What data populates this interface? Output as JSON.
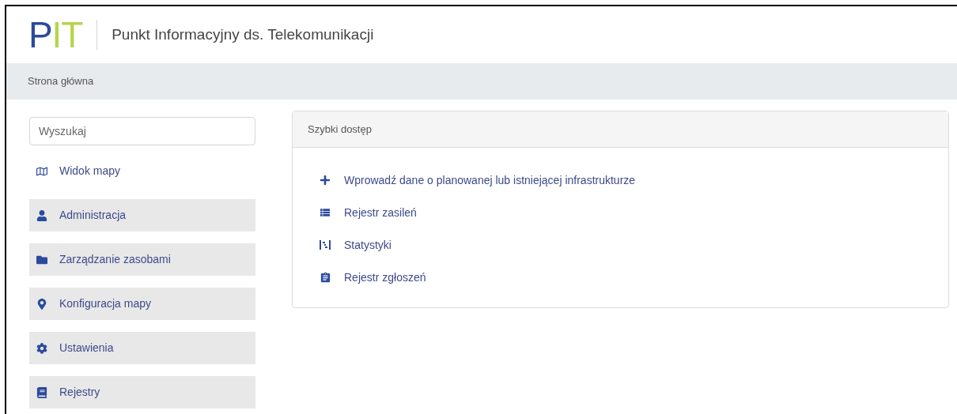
{
  "header": {
    "logo": [
      {
        "text": "P",
        "color": "#2b4a9c"
      },
      {
        "text": "IT",
        "color": "#b7d44a"
      }
    ],
    "title": "Punkt Informacyjny ds. Telekomunikacji"
  },
  "breadcrumb": "Strona główna",
  "sidebar": {
    "search": {
      "placeholder": "Wyszukaj"
    },
    "items": [
      {
        "label": "Widok mapy",
        "kind": "link"
      },
      {
        "label": "Administracja",
        "kind": "section"
      },
      {
        "label": "Zarządzanie zasobami",
        "kind": "section"
      },
      {
        "label": "Konfiguracja mapy",
        "kind": "section"
      },
      {
        "label": "Ustawienia",
        "kind": "section"
      },
      {
        "label": "Rejestry",
        "kind": "section"
      }
    ]
  },
  "quick_access": {
    "title": "Szybki dostęp",
    "links": [
      "Wprowadź dane o planowanej lub istniejącej infrastrukturze",
      "Rejestr zasileń",
      "Statystyki",
      "Rejestr zgłoszeń"
    ]
  }
}
